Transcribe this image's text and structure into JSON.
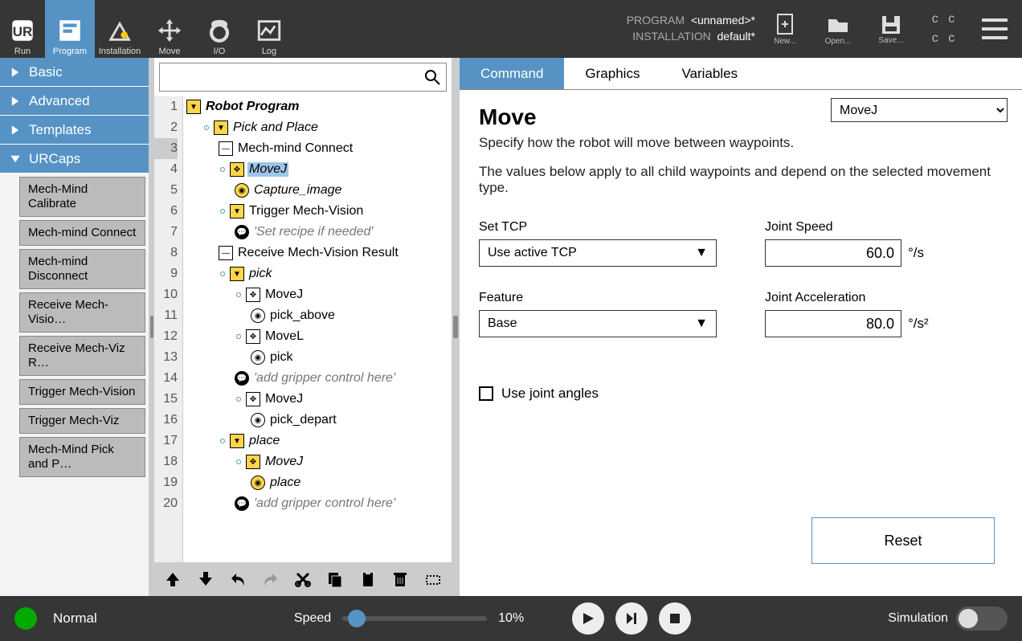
{
  "top_nav": {
    "run": "Run",
    "program": "Program",
    "installation": "Installation",
    "move": "Move",
    "io": "I/O",
    "log": "Log"
  },
  "header": {
    "program_label": "PROGRAM",
    "program_value": "<unnamed>*",
    "installation_label": "INSTALLATION",
    "installation_value": "default*",
    "new": "New...",
    "open": "Open...",
    "save": "Save..."
  },
  "sidebar": {
    "basic": "Basic",
    "advanced": "Advanced",
    "templates": "Templates",
    "urcaps": "URCaps",
    "items": [
      "Mech-Mind Calibrate",
      "Mech-mind Connect",
      "Mech-mind Disconnect",
      "Receive Mech-Visio…",
      "Receive Mech-Viz R…",
      "Trigger Mech-Vision",
      "Trigger Mech-Viz",
      "Mech-Mind Pick and P…"
    ]
  },
  "tree": {
    "lines": [
      {
        "n": 1,
        "indent": 0,
        "tag": "fold",
        "txt": "Robot Program",
        "cls": "bold italic"
      },
      {
        "n": 2,
        "indent": 1,
        "anchor": true,
        "tag": "fold",
        "txt": "Pick and Place",
        "cls": "italic"
      },
      {
        "n": 3,
        "indent": 2,
        "tag": "minus",
        "txt": "Mech-mind Connect",
        "cls": "",
        "sel": true
      },
      {
        "n": 4,
        "indent": 2,
        "anchor": true,
        "tag": "move",
        "txt": "MoveJ",
        "cls": "italic",
        "hl": true,
        "yellow": true
      },
      {
        "n": 5,
        "indent": 3,
        "tag": "wp",
        "txt": "Capture_image",
        "cls": "italic",
        "yellow": true
      },
      {
        "n": 6,
        "indent": 2,
        "anchor": true,
        "tag": "fold",
        "txt": "Trigger Mech-Vision",
        "cls": ""
      },
      {
        "n": 7,
        "indent": 3,
        "tag": "cmt",
        "txt": "'Set recipe if needed'",
        "cls": "italic",
        "grey": true
      },
      {
        "n": 8,
        "indent": 2,
        "tag": "minus",
        "txt": "Receive Mech-Vision Result",
        "cls": ""
      },
      {
        "n": 9,
        "indent": 2,
        "anchor": true,
        "tag": "fold",
        "txt": "pick",
        "cls": "italic"
      },
      {
        "n": 10,
        "indent": 3,
        "anchor": true,
        "tag": "move",
        "txt": "MoveJ",
        "cls": ""
      },
      {
        "n": 11,
        "indent": 4,
        "tag": "wp",
        "txt": "pick_above",
        "cls": ""
      },
      {
        "n": 12,
        "indent": 3,
        "anchor": true,
        "tag": "move",
        "txt": "MoveL",
        "cls": ""
      },
      {
        "n": 13,
        "indent": 4,
        "tag": "wp",
        "txt": "pick",
        "cls": ""
      },
      {
        "n": 14,
        "indent": 3,
        "tag": "cmt",
        "txt": "'add gripper control here'",
        "cls": "italic",
        "grey": true
      },
      {
        "n": 15,
        "indent": 3,
        "anchor": true,
        "tag": "move",
        "txt": "MoveJ",
        "cls": ""
      },
      {
        "n": 16,
        "indent": 4,
        "tag": "wp",
        "txt": "pick_depart",
        "cls": ""
      },
      {
        "n": 17,
        "indent": 2,
        "anchor": true,
        "tag": "fold",
        "txt": "place",
        "cls": "italic"
      },
      {
        "n": 18,
        "indent": 3,
        "anchor": true,
        "tag": "move",
        "txt": "MoveJ",
        "cls": "italic",
        "yellow": true
      },
      {
        "n": 19,
        "indent": 4,
        "tag": "wp",
        "txt": "place",
        "cls": "italic",
        "yellow": true
      },
      {
        "n": 20,
        "indent": 3,
        "tag": "cmt",
        "txt": "'add gripper control here'",
        "cls": "italic",
        "grey": true
      }
    ]
  },
  "cmd_tabs": {
    "command": "Command",
    "graphics": "Graphics",
    "variables": "Variables"
  },
  "move_panel": {
    "title": "Move",
    "subtitle": "Specify how the robot will move between waypoints.",
    "desc2": "The values below apply to all child waypoints and depend on the selected movement type.",
    "type": "MoveJ",
    "set_tcp_label": "Set TCP",
    "set_tcp_value": "Use active TCP",
    "feature_label": "Feature",
    "feature_value": "Base",
    "joint_speed_label": "Joint Speed",
    "joint_speed_value": "60.0",
    "joint_speed_unit": "°/s",
    "joint_acc_label": "Joint Acceleration",
    "joint_acc_value": "80.0",
    "joint_acc_unit": "°/s²",
    "use_joint_angles": "Use joint angles",
    "reset": "Reset"
  },
  "bottom": {
    "status": "Normal",
    "speed_label": "Speed",
    "speed_value": "10%",
    "simulation": "Simulation"
  }
}
